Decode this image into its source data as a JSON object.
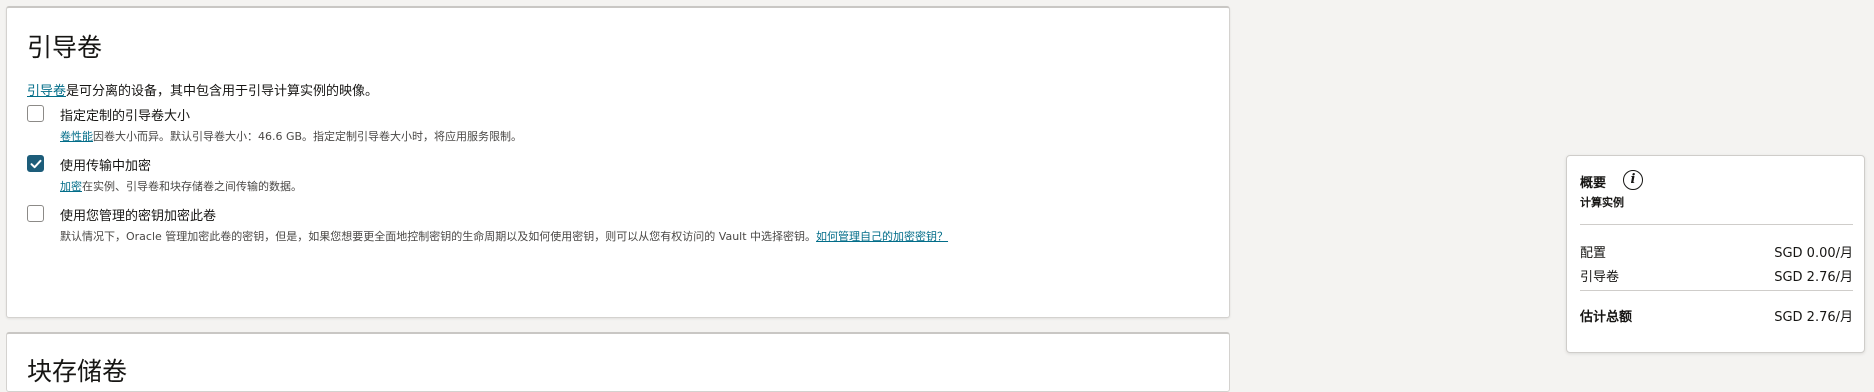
{
  "boot_volume": {
    "title": "引导卷",
    "intro_link": "引导卷",
    "intro_text": "是可分离的设备，其中包含用于引导计算实例的映像。",
    "options": [
      {
        "label": "指定定制的引导卷大小",
        "checked": false,
        "help_link": "卷性能",
        "help_text": "因卷大小而异。默认引导卷大小：46.6 GB。指定定制引导卷大小时，将应用服务限制。"
      },
      {
        "label": "使用传输中加密",
        "checked": true,
        "help_link": "加密",
        "help_text": "在实例、引导卷和块存储卷之间传输的数据。"
      },
      {
        "label": "使用您管理的密钥加密此卷",
        "checked": false,
        "help_text": "默认情况下，Oracle 管理加密此卷的密钥，但是，如果您想要更全面地控制密钥的生命周期以及如何使用密钥，则可以从您有权访问的 Vault 中选择密钥。",
        "help_link": "如何管理自己的加密密钥？"
      }
    ]
  },
  "block_volume": {
    "title": "块存储卷"
  },
  "summary": {
    "title": "概要",
    "info_icon": "i",
    "subtitle": "计算实例",
    "rows": [
      {
        "label": "配置",
        "value": "SGD 0.00/月"
      },
      {
        "label": "引导卷",
        "value": "SGD 2.76/月"
      }
    ],
    "total": {
      "label": "估计总额",
      "value": "SGD 2.76/月"
    }
  },
  "colors": {
    "link": "#026d89",
    "checkbox_checked": "#1d5d7a"
  }
}
